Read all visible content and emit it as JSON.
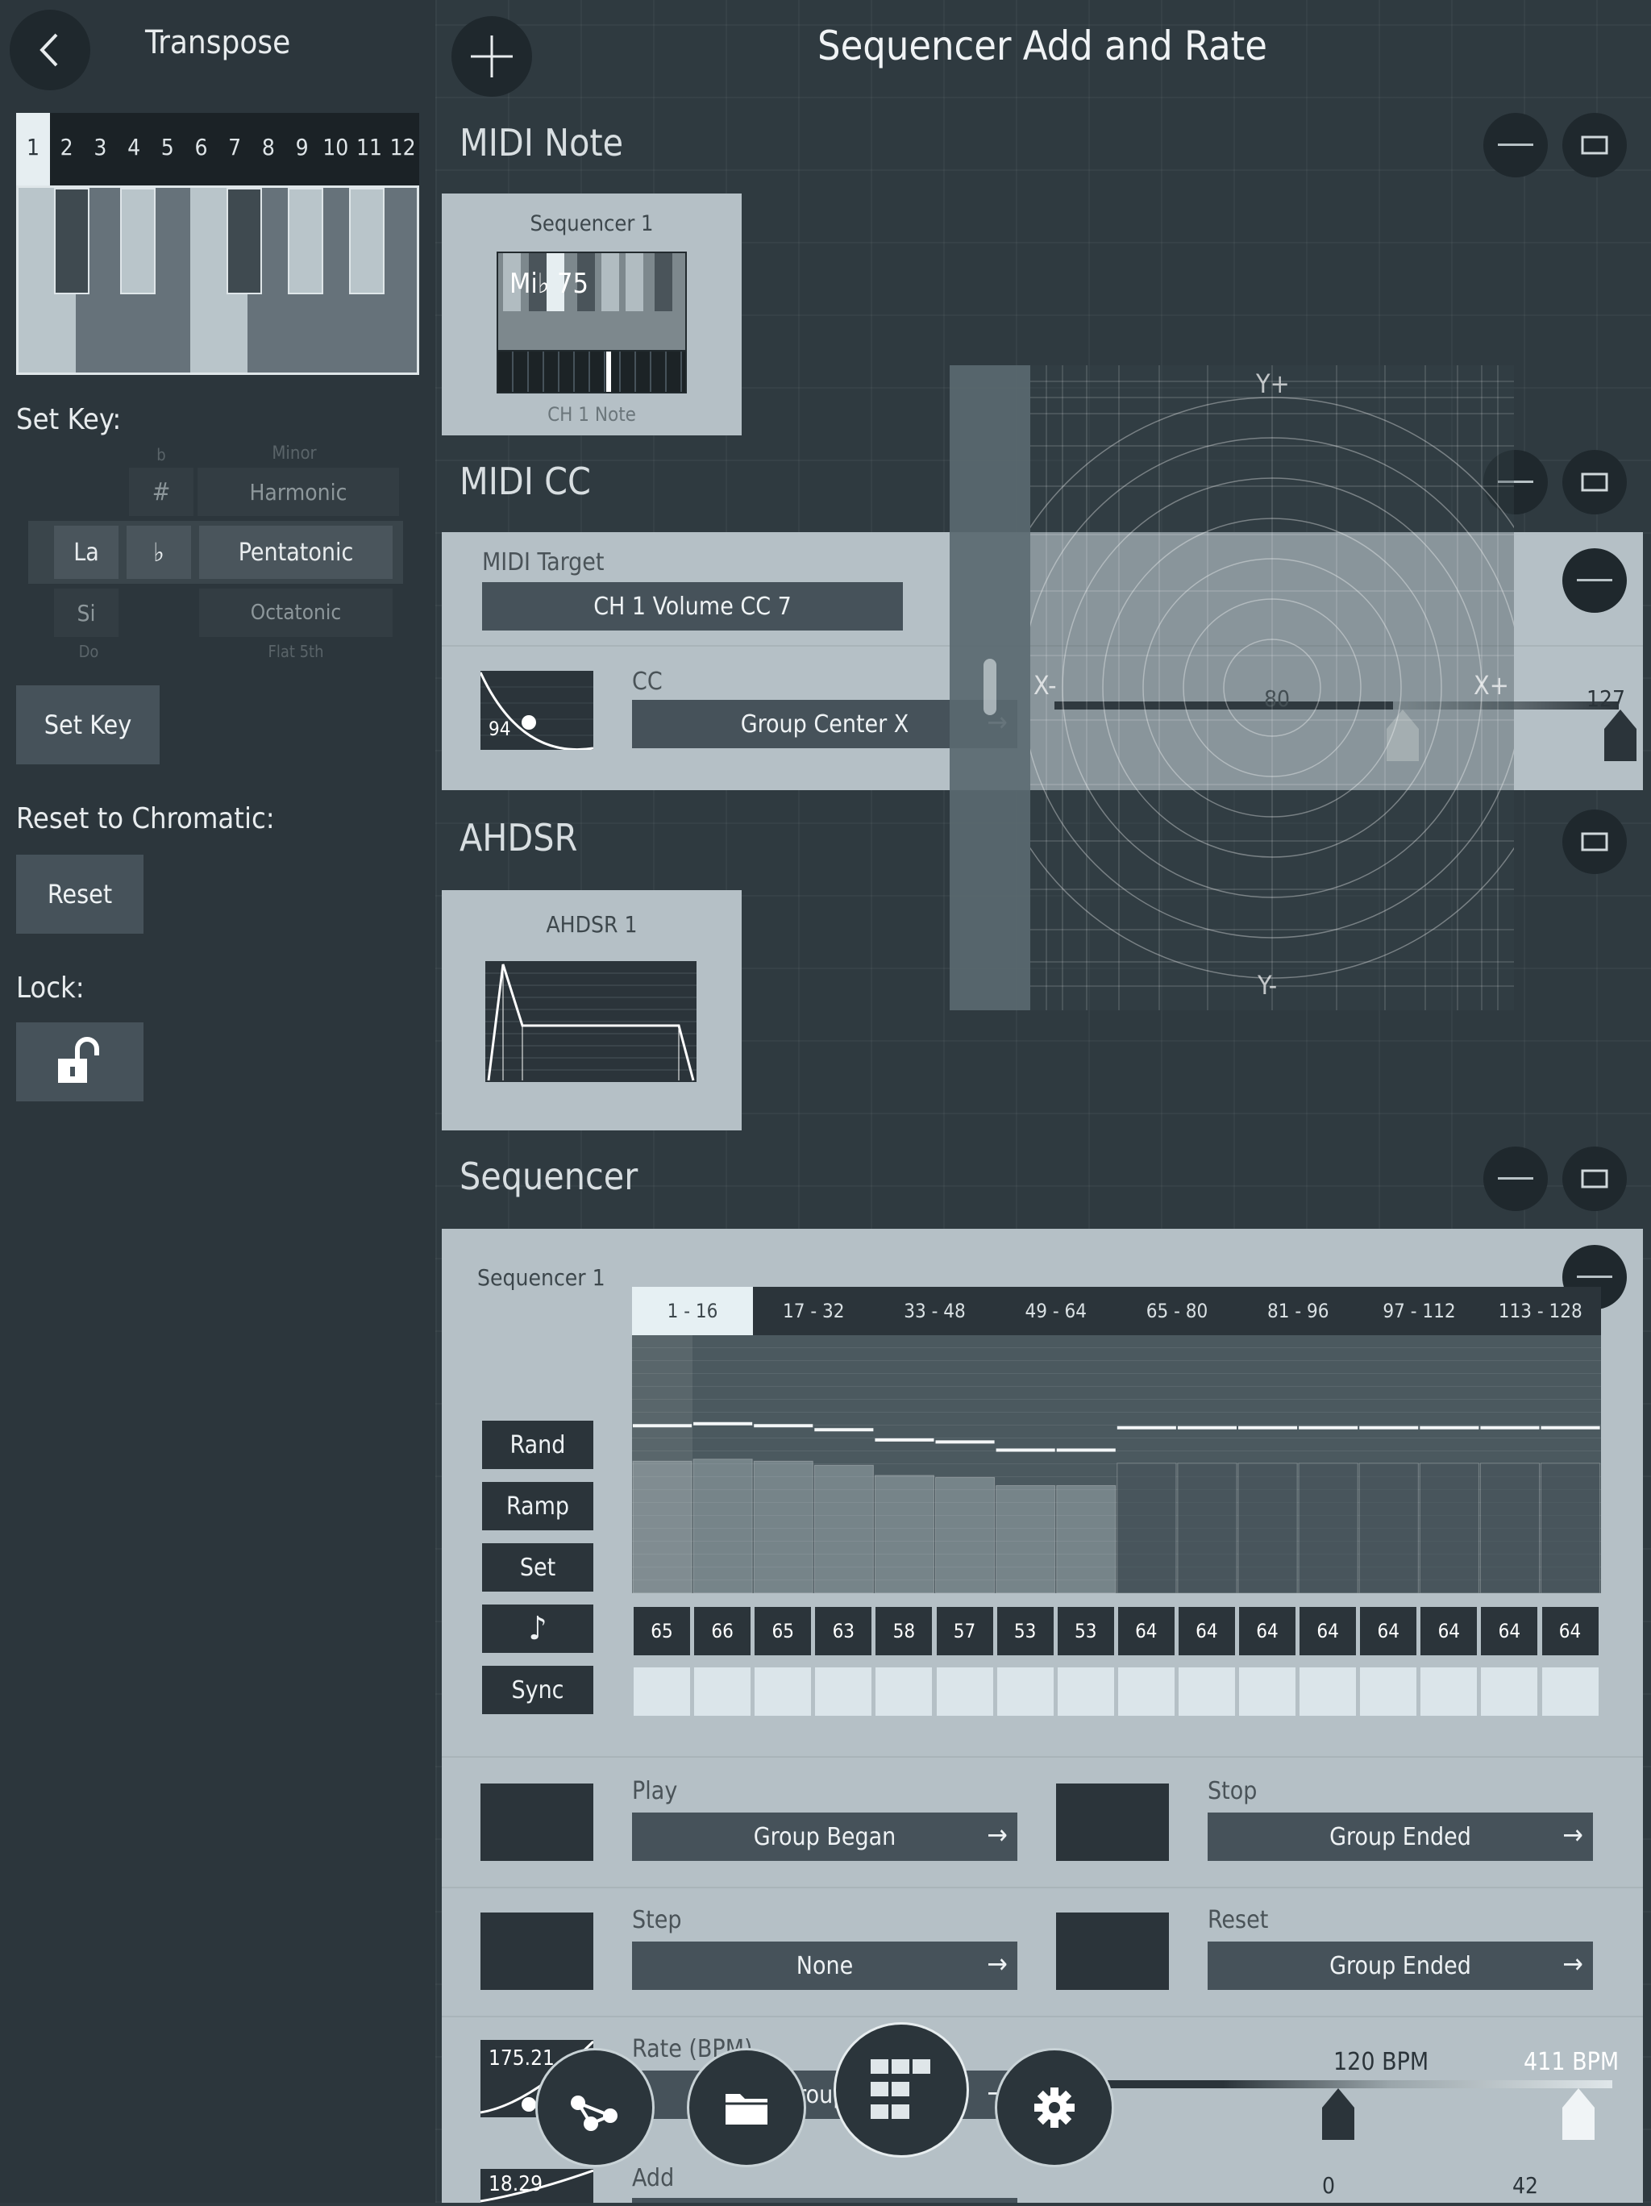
{
  "transpose": {
    "title": "Transpose",
    "key_numbers": [
      "1",
      "2",
      "3",
      "4",
      "5",
      "6",
      "7",
      "8",
      "9",
      "10",
      "11",
      "12"
    ],
    "set_key_label": "Set Key:",
    "picker_left": [
      "La",
      "Si"
    ],
    "picker_mid": [
      "#",
      "♭"
    ],
    "picker_right": [
      "Harmonic",
      "Pentatonic",
      "Octatonic"
    ],
    "picker_ghost_top": "Minor",
    "picker_ghost_bottom": "Flat 5th",
    "picker_ghost_do": "Do",
    "set_key_button": "Set Key",
    "reset_label": "Reset to Chromatic:",
    "reset_button": "Reset",
    "lock_label": "Lock:"
  },
  "header": {
    "title": "Sequencer Add and Rate"
  },
  "midi_note": {
    "title": "MIDI Note",
    "card_title": "Sequencer 1",
    "note_display": "Mi♭ 75",
    "card_footer": "CH 1 Note"
  },
  "midi_cc": {
    "title": "MIDI CC",
    "target_label": "MIDI Target",
    "target_value": "CH 1 Volume CC 7",
    "curve_value": "94",
    "cc_label": "CC",
    "cc_value": "Group Center X",
    "slider_value": "80",
    "slider_max": "127"
  },
  "xy_pad": {
    "y_plus": "Y+",
    "y_minus": "Y-",
    "x_minus": "X-",
    "x_plus": "X+"
  },
  "ahdsr": {
    "title": "AHDSR",
    "card_title": "AHDSR 1"
  },
  "sequencer": {
    "title": "Sequencer",
    "card_title": "Sequencer 1",
    "tabs": [
      "1 - 16",
      "17 - 32",
      "33 - 48",
      "49 - 64",
      "65 - 80",
      "81 - 96",
      "97 - 112",
      "113 - 128"
    ],
    "buttons": {
      "rand": "Rand",
      "ramp": "Ramp",
      "set": "Set",
      "sync": "Sync"
    },
    "step_values": [
      65,
      66,
      65,
      63,
      58,
      57,
      53,
      53,
      64,
      64,
      64,
      64,
      64,
      64,
      64,
      64
    ],
    "play_label": "Play",
    "play_value": "Group Began",
    "stop_label": "Stop",
    "stop_value": "Group Ended",
    "step_label": "Step",
    "step_value": "None",
    "reset_label": "Reset",
    "reset_value": "Group Ended",
    "rate_label": "Rate (BPM)",
    "rate_curve_value": "175.21",
    "rate_target": "Group C",
    "rate_slider_value": "120 BPM",
    "rate_slider_max": "411 BPM",
    "add_label": "Add",
    "add_curve_value": "18.29",
    "add_slider_value": "0",
    "add_slider_max": "42"
  },
  "colors": {
    "background": "#2f3a40",
    "card": "#b5c0c6",
    "dark_button": "#46525a"
  }
}
